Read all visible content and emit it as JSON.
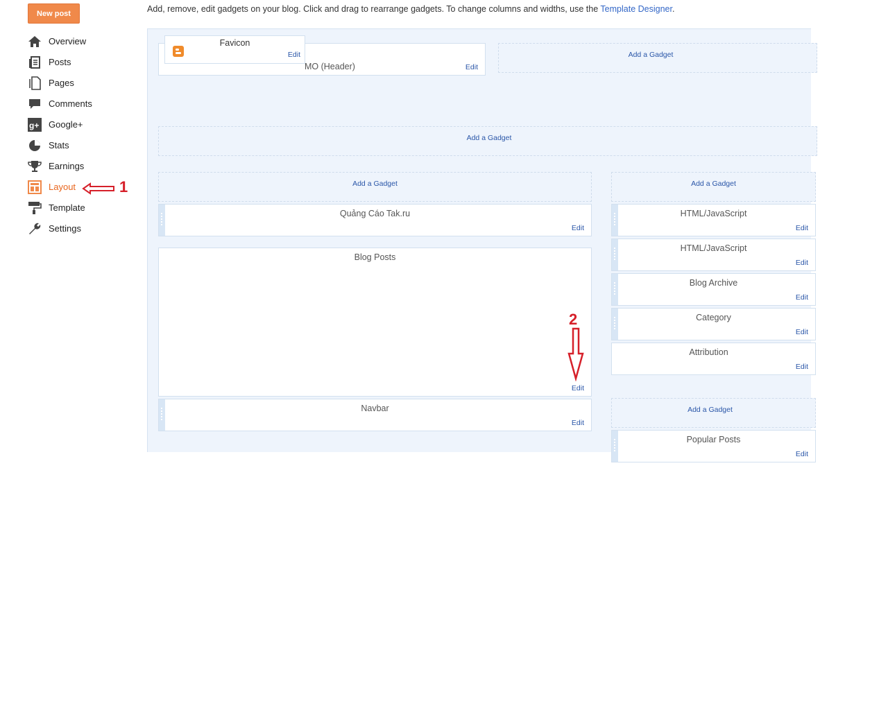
{
  "sidebar": {
    "new_post": "New post",
    "items": [
      {
        "label": "Overview",
        "icon": "home-icon"
      },
      {
        "label": "Posts",
        "icon": "posts-icon"
      },
      {
        "label": "Pages",
        "icon": "pages-icon"
      },
      {
        "label": "Comments",
        "icon": "comments-icon"
      },
      {
        "label": "Google+",
        "icon": "google-plus-icon"
      },
      {
        "label": "Stats",
        "icon": "stats-icon"
      },
      {
        "label": "Earnings",
        "icon": "trophy-icon"
      },
      {
        "label": "Layout",
        "icon": "layout-icon",
        "active": true
      },
      {
        "label": "Template",
        "icon": "paint-roller-icon"
      },
      {
        "label": "Settings",
        "icon": "wrench-icon"
      }
    ]
  },
  "intro": {
    "text": "Add, remove, edit gadgets on your blog. Click and drag to rearrange gadgets. To change columns and widths, use the ",
    "link": "Template Designer",
    "suffix": "."
  },
  "layout": {
    "header_partial": "MO (Header)",
    "favicon": "Favicon",
    "edit": "Edit",
    "add_gadget": "Add a Gadget",
    "main_gadgets": [
      "Quảng Cáo Tak.ru",
      "Blog Posts",
      "Navbar"
    ],
    "side_gadgets": [
      "HTML/JavaScript",
      "HTML/JavaScript",
      "Blog Archive",
      "Category",
      "Attribution"
    ],
    "side_bottom_gadget": "Popular Posts"
  },
  "annotations": {
    "one": "1",
    "two": "2"
  },
  "colors": {
    "accent": "#f0894a",
    "annotation": "#d6202a",
    "link": "#2a56a8"
  }
}
